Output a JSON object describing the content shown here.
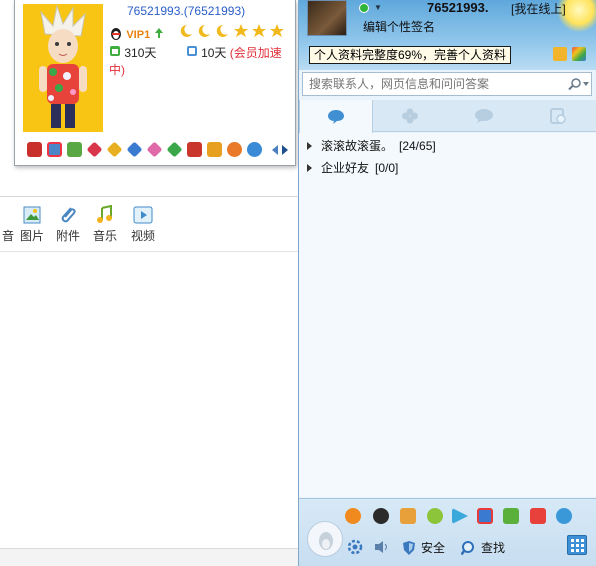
{
  "card": {
    "id_text": "76521993.(76521993)",
    "vip_label": "VIP1",
    "active_days": "310天",
    "speed_days": "10天",
    "speed_note": "(会员加速中)"
  },
  "left_toolbar": {
    "items": [
      "音",
      "图片",
      "附件",
      "音乐",
      "视频"
    ]
  },
  "profile": {
    "nickname": "76521993.",
    "status": "[我在线上]",
    "signature": "编辑个性签名",
    "completion_tip": "个人资料完整度69%，完善个人资料"
  },
  "search": {
    "placeholder": "搜索联系人，网页信息和问问答案"
  },
  "tabs": [
    "contacts-tab",
    "favorites-tab",
    "chat-tab",
    "recent-tab"
  ],
  "groups": [
    {
      "name": "滚滚故滚蛋。",
      "count": "[24/65]"
    },
    {
      "name": "企业好友",
      "count": "[0/0]"
    }
  ],
  "bottom": {
    "settings_label": "",
    "security_label": "安全",
    "find_label": "查找"
  },
  "colors": {
    "link_blue": "#2a5ec7",
    "speed_red": "#e0303a",
    "vip_orange": "#e8800c",
    "panel_bg": "#e9f3fb"
  }
}
